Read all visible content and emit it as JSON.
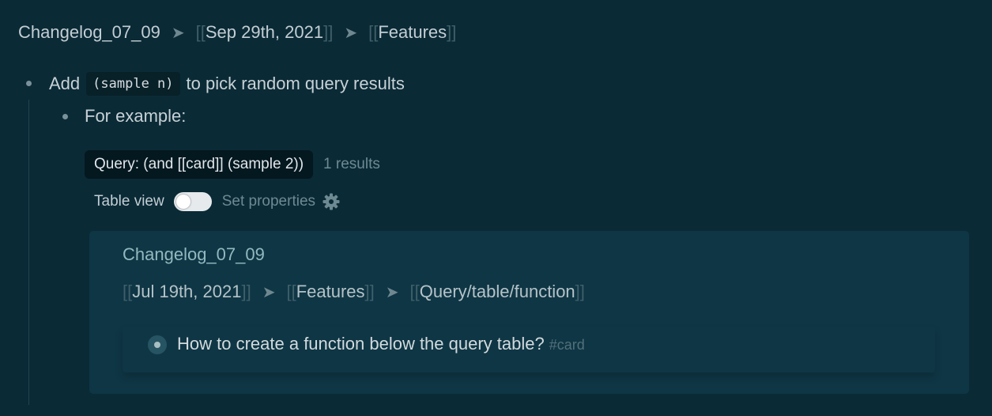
{
  "breadcrumb": {
    "page": "Changelog_07_09",
    "separator": "➤",
    "bracket_open": "[[",
    "bracket_close": "]]",
    "links": [
      "Sep 29th, 2021",
      "Features"
    ]
  },
  "block1": {
    "prefix": "Add",
    "code": "(sample n)",
    "suffix": "to pick random query results"
  },
  "block2": {
    "text": "For example:"
  },
  "query": {
    "label": "Query: (and [[card]] (sample 2))",
    "results": "1 results"
  },
  "view": {
    "table_view_label": "Table view",
    "table_view_on": false,
    "set_properties_label": "Set properties"
  },
  "result_card": {
    "page_title": "Changelog_07_09",
    "links": [
      "Jul 19th, 2021",
      "Features",
      "Query/table/function"
    ],
    "item_text": "How to create a function below the query table?",
    "item_tag": "#card"
  },
  "colors": {
    "background": "#0a2a36",
    "card_background": "#0f3645",
    "accent_title": "#93b9bf"
  }
}
